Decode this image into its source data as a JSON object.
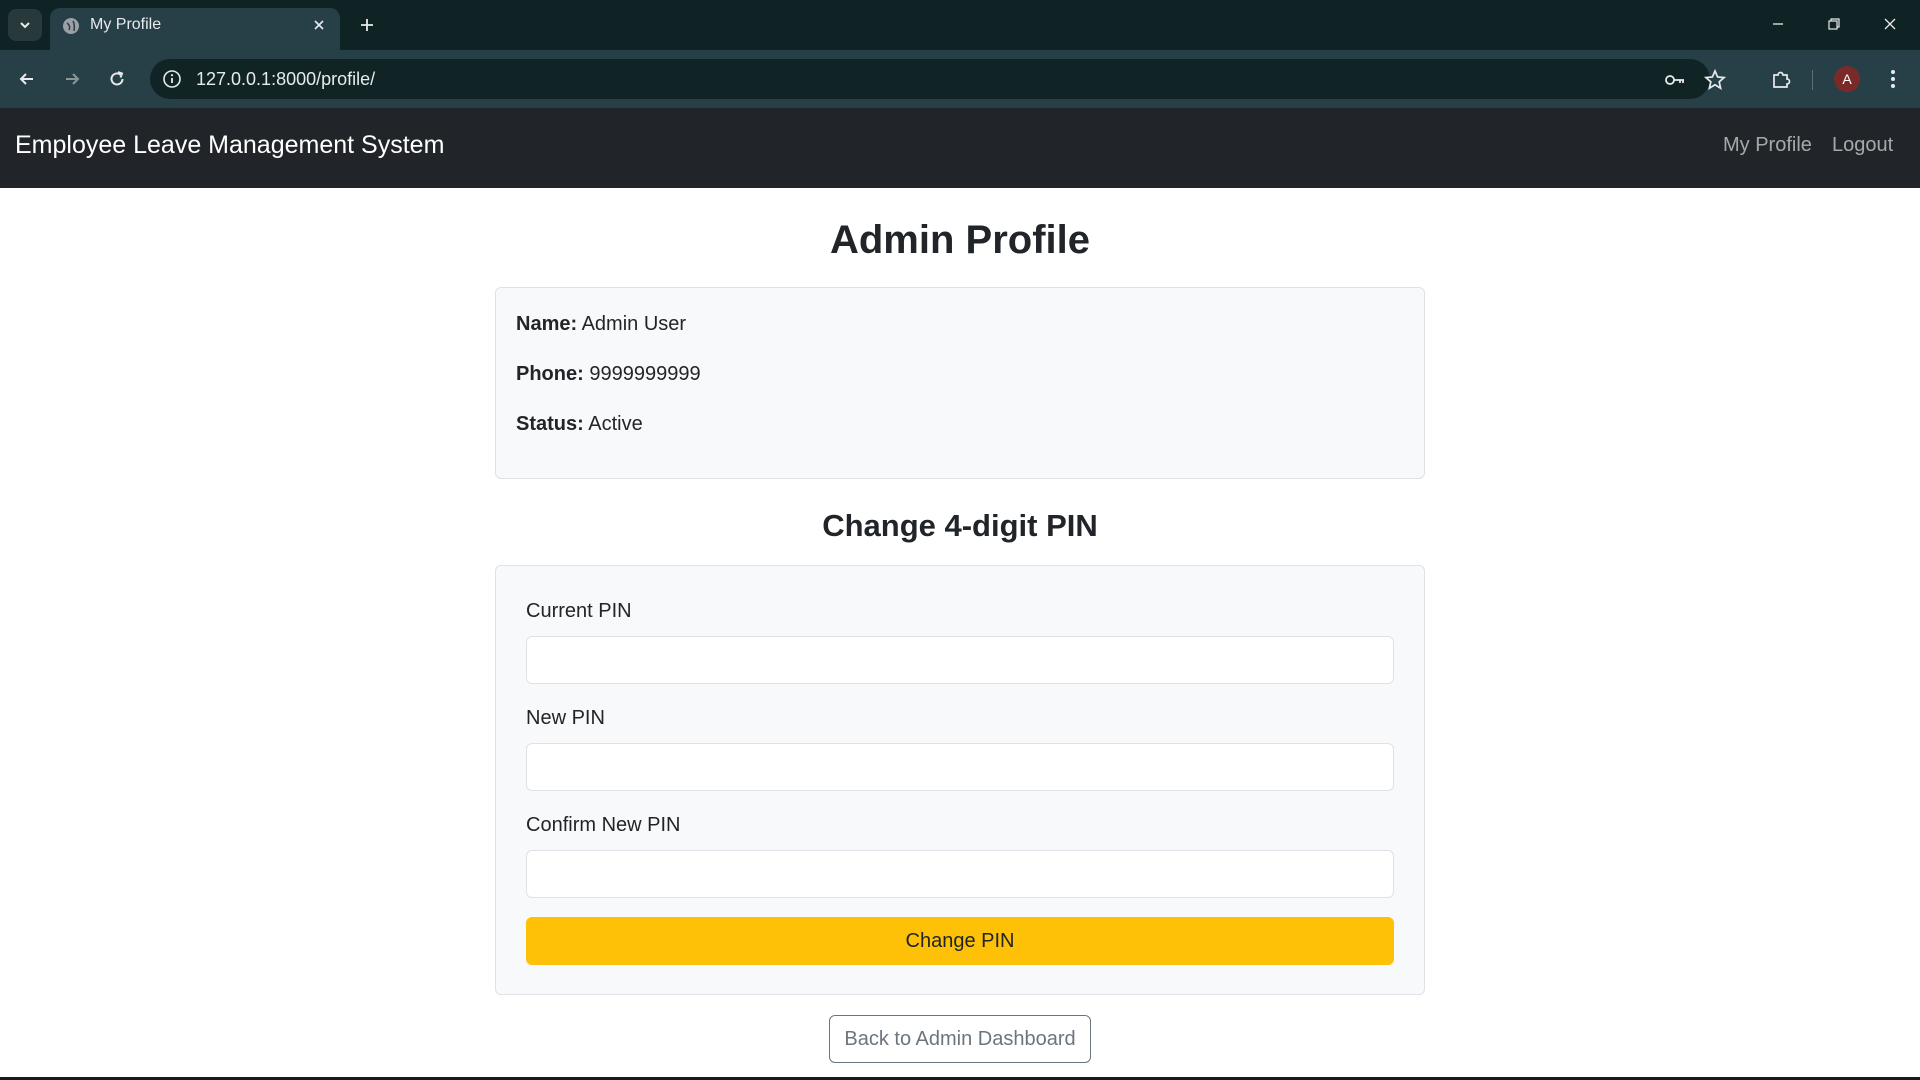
{
  "browser": {
    "tab_title": "My Profile",
    "url": "127.0.0.1:8000/profile/",
    "profile_initial": "A"
  },
  "navbar": {
    "brand": "Employee Leave Management System",
    "links": [
      {
        "label": "My Profile"
      },
      {
        "label": "Logout"
      }
    ]
  },
  "profile": {
    "title": "Admin Profile",
    "fields": [
      {
        "label": "Name:",
        "value": "Admin User"
      },
      {
        "label": "Phone:",
        "value": "9999999999"
      },
      {
        "label": "Status:",
        "value": "Active"
      }
    ]
  },
  "pin_form": {
    "title": "Change 4-digit PIN",
    "fields": [
      {
        "label": "Current PIN",
        "value": ""
      },
      {
        "label": "New PIN",
        "value": ""
      },
      {
        "label": "Confirm New PIN",
        "value": ""
      }
    ],
    "submit_label": "Change PIN"
  },
  "back_button": "Back to Admin Dashboard",
  "colors": {
    "navbar_bg": "#212529",
    "warning": "#ffc107",
    "secondary": "#6c757d",
    "card_bg": "#f8f9fa"
  }
}
